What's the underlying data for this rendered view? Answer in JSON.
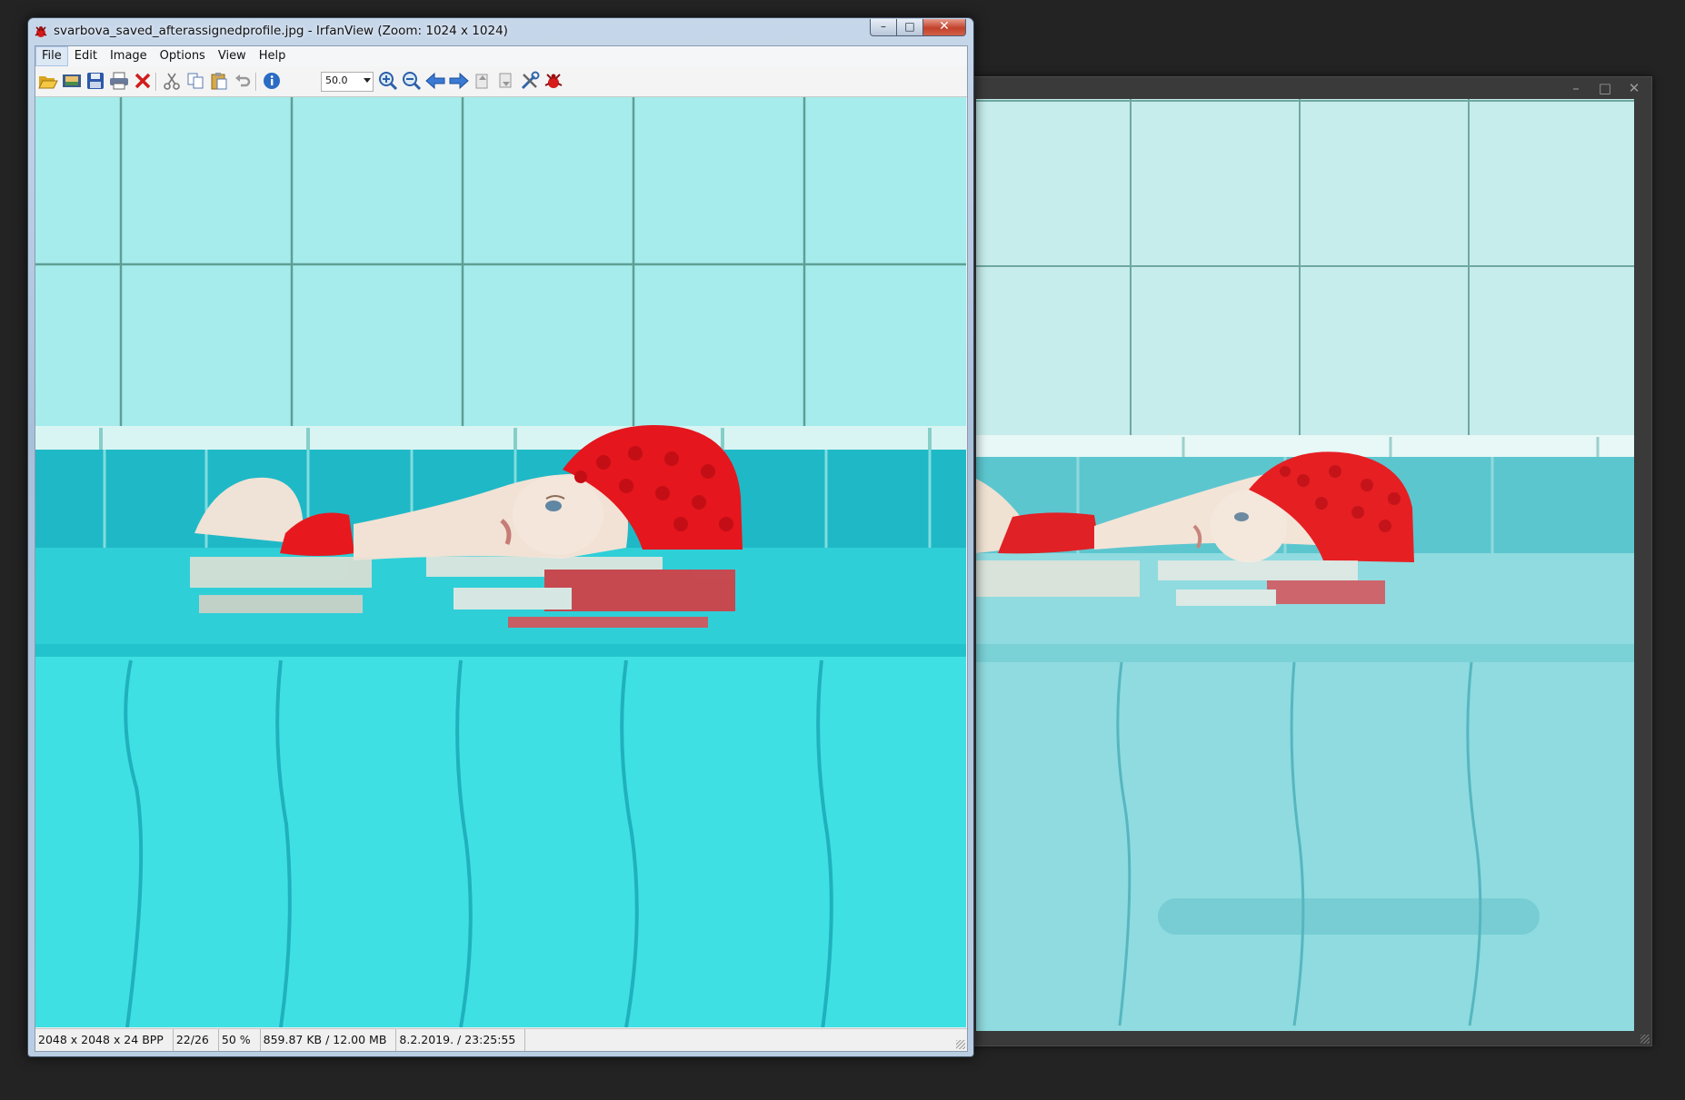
{
  "window": {
    "title": "svarbova_saved_afterassignedprofile.jpg - IrfanView (Zoom: 1024 x 1024)",
    "controls": {
      "minimize": "–",
      "maximize": "□",
      "close": "✕"
    }
  },
  "menu": [
    {
      "label": "File",
      "active": true
    },
    {
      "label": "Edit"
    },
    {
      "label": "Image"
    },
    {
      "label": "Options"
    },
    {
      "label": "View"
    },
    {
      "label": "Help"
    }
  ],
  "toolbar": {
    "buttons": [
      "open-folder-icon",
      "slideshow-icon",
      "save-icon",
      "print-icon",
      "delete-icon",
      "cut-icon",
      "copy-icon",
      "paste-icon",
      "undo-icon",
      "info-icon",
      "zoom-in-icon",
      "zoom-out-icon",
      "previous-icon",
      "next-icon",
      "move-up-icon",
      "move-down-icon",
      "settings-icon",
      "irfanview-icon"
    ],
    "zoom_value": "50.0"
  },
  "statusbar": {
    "dimensions": "2048 x 2048 x 24 BPP",
    "index": "22/26",
    "zoom": "50 %",
    "size": "859.87 KB / 12.00 MB",
    "datetime": "8.2.2019. / 23:25:55"
  },
  "back_window": {
    "controls": {
      "minimize": "–",
      "maximize": "□",
      "close": "✕"
    }
  },
  "colors": {
    "front_water": "#3fe0e3",
    "back_water": "#8fdbe0",
    "cap_red": "#e81e25",
    "window_close": "#c2412b"
  }
}
